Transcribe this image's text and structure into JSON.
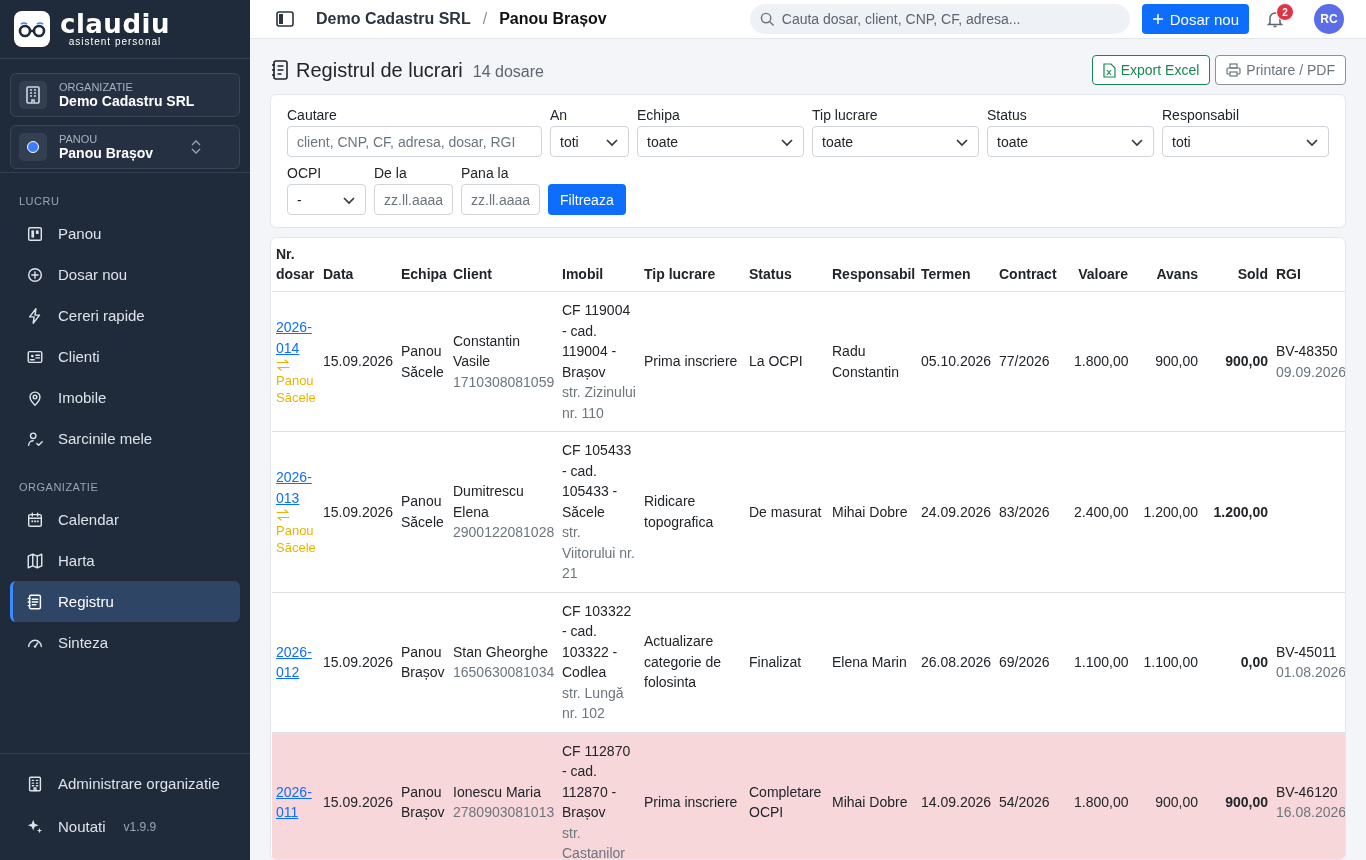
{
  "brand": {
    "name": "claudiu",
    "tagline": "asistent personal"
  },
  "org_switcher": {
    "label": "ORGANIZATIE",
    "value": "Demo Cadastru SRL"
  },
  "panel_switcher": {
    "label": "PANOU",
    "value": "Panou Brașov"
  },
  "sidebar": {
    "sections": [
      {
        "title": "LUCRU",
        "items": [
          {
            "label": "Panou",
            "selected": false
          },
          {
            "label": "Dosar nou",
            "selected": false
          },
          {
            "label": "Cereri rapide",
            "selected": false
          },
          {
            "label": "Clienti",
            "selected": false
          },
          {
            "label": "Imobile",
            "selected": false
          },
          {
            "label": "Sarcinile mele",
            "selected": false
          }
        ]
      },
      {
        "title": "ORGANIZATIE",
        "items": [
          {
            "label": "Calendar",
            "selected": false
          },
          {
            "label": "Harta",
            "selected": false
          },
          {
            "label": "Registru",
            "selected": true
          },
          {
            "label": "Sinteza",
            "selected": false
          }
        ]
      }
    ],
    "footer": [
      {
        "label": "Administrare organizatie"
      },
      {
        "label": "Noutati",
        "version": "v1.9.9"
      }
    ]
  },
  "topbar": {
    "breadcrumb": [
      "Demo Cadastru SRL",
      "Panou Brașov"
    ],
    "breadcrumb_separator": "/",
    "search": {
      "placeholder": "Cauta dosar, client, CNP, CF, adresa..."
    },
    "new_button": "Dosar nou",
    "notifications": "2",
    "avatar": "RC"
  },
  "page": {
    "title": "Registrul de lucrari",
    "count": "14 dosare",
    "actions": [
      {
        "kind": "excel",
        "label": "Export Excel"
      },
      {
        "kind": "print",
        "label": "Printare / PDF"
      }
    ]
  },
  "filters": [
    {
      "kind": "text",
      "label": "Cautare",
      "placeholder": "client, CNP, CF, adresa, dosar, RGI"
    },
    {
      "kind": "select",
      "label": "An",
      "value": "toti"
    },
    {
      "kind": "select",
      "label": "Echipa",
      "value": "toate"
    },
    {
      "kind": "select",
      "label": "Tip lucrare",
      "value": "toate"
    },
    {
      "kind": "select",
      "label": "Status",
      "value": "toate"
    },
    {
      "kind": "select",
      "label": "Responsabil",
      "value": "toti"
    },
    {
      "kind": "select",
      "label": "OCPI",
      "value": "-"
    },
    {
      "kind": "text",
      "label": "De la",
      "placeholder": "zz.ll.aaaa"
    },
    {
      "kind": "text",
      "label": "Pana la",
      "placeholder": "zz.ll.aaaa"
    },
    {
      "kind": "button",
      "label": "Filtreaza"
    }
  ],
  "table": {
    "columns": [
      "Nr. dosar",
      "Data",
      "Echipa",
      "Client",
      "Imobil",
      "Tip lucrare",
      "Status",
      "Responsabil",
      "Termen",
      "Contract",
      "Valoare",
      "Avans",
      "Sold",
      "RGI"
    ],
    "rows": [
      {
        "highlighted": false,
        "number": "2026-014",
        "transfer": "Panou Săcele",
        "date": "15.09.2026",
        "team": "Panou Săcele",
        "client": "Constantin Vasile",
        "cnp": "1710308081059",
        "property": "CF 119004 - cad. 119004 - Brașov",
        "address": "str. Zizinului nr. 110",
        "work_type": "Prima inscriere",
        "status": "La OCPI",
        "responsible": "Radu Constantin",
        "deadline": "05.10.2026",
        "contract": "77/2026",
        "value": "1.800,00",
        "advance": "900,00",
        "balance": "900,00",
        "rgi": "BV-48350",
        "rgi_date": "09.09.2026"
      },
      {
        "highlighted": false,
        "number": "2026-013",
        "transfer": "Panou Săcele",
        "date": "15.09.2026",
        "team": "Panou Săcele",
        "client": "Dumitrescu Elena",
        "cnp": "2900122081028",
        "property": "CF 105433 - cad. 105433 - Săcele",
        "address": "str. Viitorului nr. 21",
        "work_type": "Ridicare topografica",
        "status": "De masurat",
        "responsible": "Mihai Dobre",
        "deadline": "24.09.2026",
        "contract": "83/2026",
        "value": "2.400,00",
        "advance": "1.200,00",
        "balance": "1.200,00"
      },
      {
        "highlighted": false,
        "number": "2026-012",
        "date": "15.09.2026",
        "team": "Panou Brașov",
        "client": "Stan Gheorghe",
        "cnp": "1650630081034",
        "property": "CF 103322 - cad. 103322 - Codlea",
        "address": "str. Lungă nr. 102",
        "work_type": "Actualizare categorie de folosinta",
        "status": "Finalizat",
        "responsible": "Elena Marin",
        "deadline": "26.08.2026",
        "contract": "69/2026",
        "value": "1.100,00",
        "advance": "1.100,00",
        "balance": "0,00",
        "rgi": "BV-45011",
        "rgi_date": "01.08.2026"
      },
      {
        "highlighted": true,
        "number": "2026-011",
        "date": "15.09.2026",
        "team": "Panou Brașov",
        "client": "Ionescu Maria",
        "cnp": "2780903081013",
        "property": "CF 112870 - cad. 112870 - Brașov",
        "address": "str. Castanilor",
        "work_type": "Prima inscriere",
        "status": "Completare OCPI",
        "responsible": "Mihai Dobre",
        "deadline": "14.09.2026",
        "contract": "54/2026",
        "value": "1.800,00",
        "advance": "900,00",
        "balance": "900,00",
        "rgi": "BV-46120",
        "rgi_date": "16.08.2026"
      }
    ]
  }
}
